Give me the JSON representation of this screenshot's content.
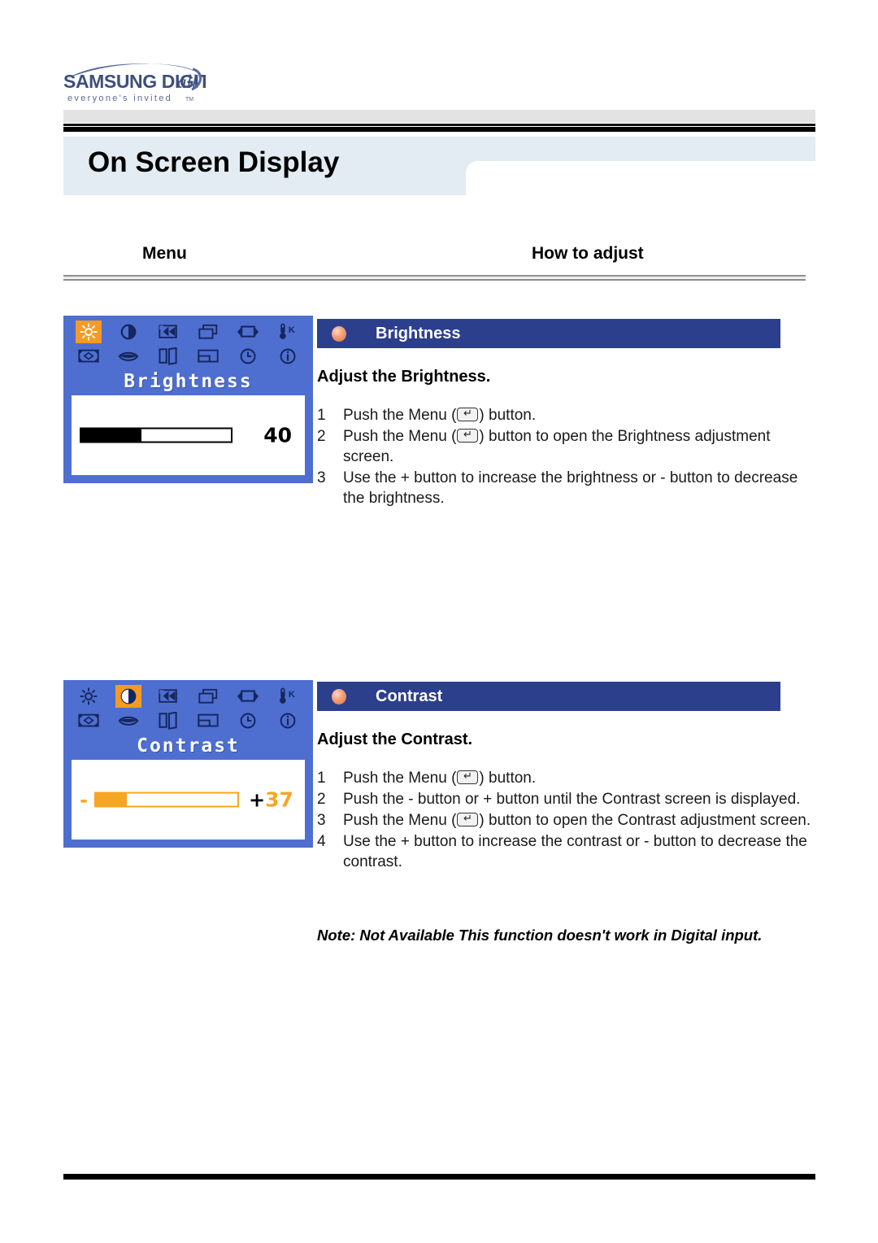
{
  "brand": {
    "name": "SAMSUNG DIGITall",
    "tagline": "everyone's invited",
    "tm": "TM"
  },
  "header": {
    "title": "On Screen Display"
  },
  "columns": {
    "menu": "Menu",
    "how_to_adjust": "How to adjust"
  },
  "osd_icons": {
    "row1": [
      "brightness-icon",
      "contrast-icon",
      "image-lock-icon",
      "position-icon",
      "image-size-icon",
      "color-temp-icon"
    ],
    "row2": [
      "geometry-icon",
      "language-icon",
      "pip-icon",
      "osd-position-icon",
      "osd-time-icon",
      "information-icon"
    ]
  },
  "sections": [
    {
      "id": "brightness",
      "osd": {
        "label": "Brightness",
        "value": "40",
        "fill_percent": 40,
        "selected_icon_index": 0,
        "style": "mono",
        "minus": "",
        "plus": ""
      },
      "header_title": "Brightness",
      "subtitle": "Adjust the Brightness.",
      "steps": [
        {
          "num": "1",
          "pre": "Push the Menu (",
          "key": "menu-enter-key",
          "post": ") button."
        },
        {
          "num": "2",
          "pre": "Push the Menu (",
          "key": "menu-enter-key",
          "post": ") button to open the Brightness adjustment screen."
        },
        {
          "num": "3",
          "pre": "Use the + button to increase the brightness or - button to decrease the brightness.",
          "key": "",
          "post": ""
        }
      ]
    },
    {
      "id": "contrast",
      "osd": {
        "label": "Contrast",
        "value": "37",
        "fill_percent": 22,
        "selected_icon_index": 1,
        "style": "amber",
        "minus": "-",
        "plus": "+"
      },
      "header_title": "Contrast",
      "subtitle": "Adjust the Contrast.",
      "steps": [
        {
          "num": "1",
          "pre": "Push the Menu (",
          "key": "menu-enter-key",
          "post": ") button."
        },
        {
          "num": "2",
          "pre": "Push the - button or + button until the Contrast screen is displayed.",
          "key": "",
          "post": ""
        },
        {
          "num": "3",
          "pre": "Push the Menu (",
          "key": "menu-enter-key",
          "post": ") button to open the Contrast adjustment screen."
        },
        {
          "num": "4",
          "pre": "Use the + button to increase the contrast or - button to decrease the contrast.",
          "key": "",
          "post": ""
        }
      ]
    }
  ],
  "note": "Note: Not Available  This function doesn't work in Digital input.",
  "colors": {
    "osd_blue": "#4e6fd0",
    "osd_amber": "#f5a623",
    "section_header_blue": "#2b3f8c",
    "title_banner": "#e2ecf2",
    "bullet_orange": "#e07a4f"
  }
}
